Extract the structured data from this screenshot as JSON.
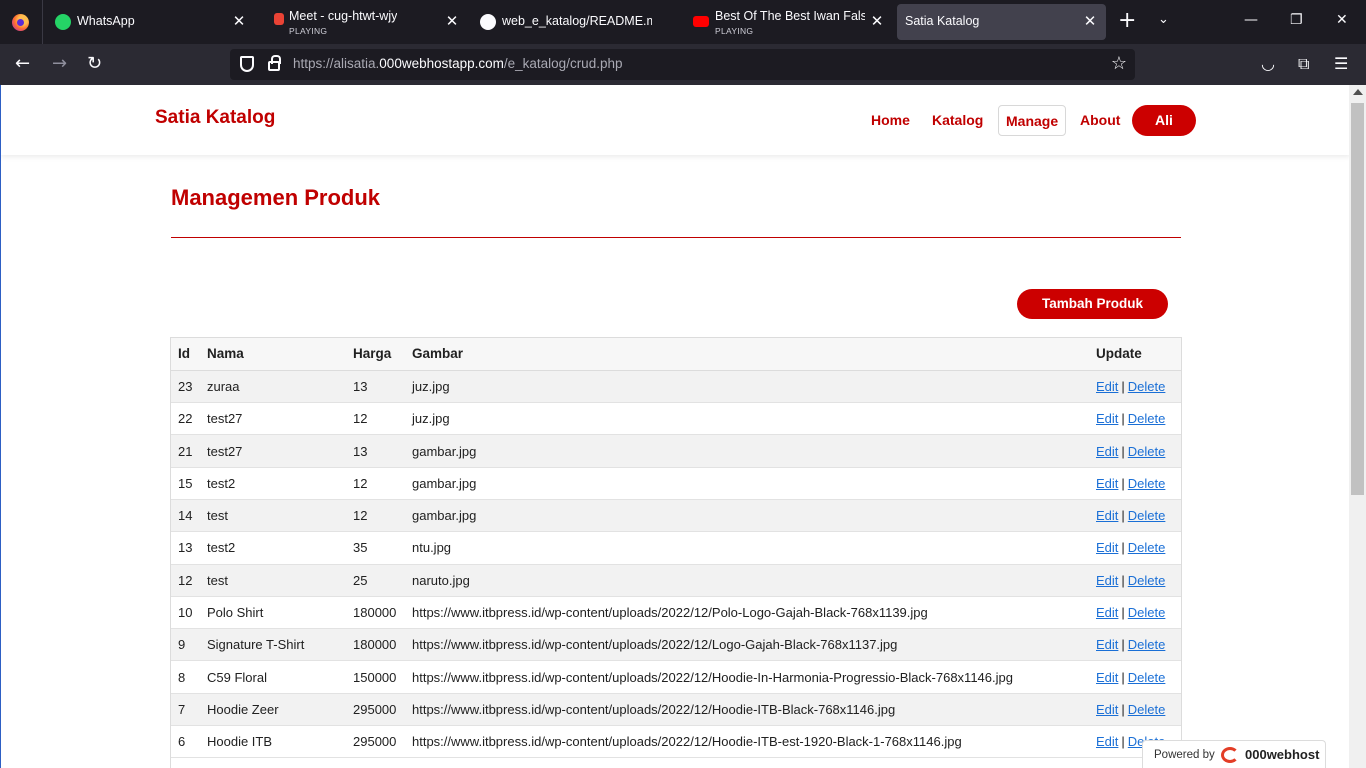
{
  "browser": {
    "tabs": [
      {
        "title": "WhatsApp",
        "sub": "",
        "icon": "whatsapp-icon",
        "color": "#25d366"
      },
      {
        "title": "Meet - cug-htwt-wjy",
        "sub": "PLAYING",
        "icon": "meet-icon",
        "color": "#ea4335"
      },
      {
        "title": "web_e_katalog/README.md",
        "sub": "",
        "icon": "github-icon",
        "color": "#ffffff"
      },
      {
        "title": "Best Of The Best Iwan Fals ~",
        "sub": "PLAYING",
        "icon": "youtube-icon",
        "color": "#ff0000"
      },
      {
        "title": "Satia Katalog",
        "sub": "",
        "icon": "page-icon",
        "color": "#cccccc"
      }
    ],
    "url_prefix": "https://alisatia.",
    "url_host": "000webhostapp.com",
    "url_path": "/e_katalog/crud.php"
  },
  "site": {
    "brand": "Satia Katalog",
    "nav": {
      "home": "Home",
      "katalog": "Katalog",
      "manage": "Manage",
      "about": "About",
      "user": "Ali"
    }
  },
  "main": {
    "title": "Managemen Produk",
    "add_button": "Tambah Produk"
  },
  "table": {
    "headers": {
      "id": "Id",
      "nama": "Nama",
      "harga": "Harga",
      "gambar": "Gambar",
      "update": "Update"
    },
    "edit_label": "Edit",
    "delete_label": "Delete",
    "rows": [
      {
        "id": "23",
        "nama": "zuraa",
        "harga": "13",
        "gambar": "juz.jpg"
      },
      {
        "id": "22",
        "nama": "test27",
        "harga": "12",
        "gambar": "juz.jpg"
      },
      {
        "id": "21",
        "nama": "test27",
        "harga": "13",
        "gambar": "gambar.jpg"
      },
      {
        "id": "15",
        "nama": "test2",
        "harga": "12",
        "gambar": "gambar.jpg"
      },
      {
        "id": "14",
        "nama": "test",
        "harga": "12",
        "gambar": "gambar.jpg"
      },
      {
        "id": "13",
        "nama": "test2",
        "harga": "35",
        "gambar": "ntu.jpg"
      },
      {
        "id": "12",
        "nama": "test",
        "harga": "25",
        "gambar": "naruto.jpg"
      },
      {
        "id": "10",
        "nama": "Polo Shirt",
        "harga": "180000",
        "gambar": "https://www.itbpress.id/wp-content/uploads/2022/12/Polo-Logo-Gajah-Black-768x1139.jpg"
      },
      {
        "id": "9",
        "nama": "Signature T-Shirt",
        "harga": "180000",
        "gambar": "https://www.itbpress.id/wp-content/uploads/2022/12/Logo-Gajah-Black-768x1137.jpg"
      },
      {
        "id": "8",
        "nama": "C59 Floral",
        "harga": "150000",
        "gambar": "https://www.itbpress.id/wp-content/uploads/2022/12/Hoodie-In-Harmonia-Progressio-Black-768x1146.jpg"
      },
      {
        "id": "7",
        "nama": "Hoodie Zeer",
        "harga": "295000",
        "gambar": "https://www.itbpress.id/wp-content/uploads/2022/12/Hoodie-ITB-Black-768x1146.jpg"
      },
      {
        "id": "6",
        "nama": "Hoodie ITB",
        "harga": "295000",
        "gambar": "https://www.itbpress.id/wp-content/uploads/2022/12/Hoodie-ITB-est-1920-Black-1-768x1146.jpg"
      }
    ]
  },
  "footer_badge": {
    "powered": "Powered by",
    "brand": "000webhost"
  },
  "colors": {
    "accent": "#cc0000",
    "link": "#1a6fd6"
  }
}
